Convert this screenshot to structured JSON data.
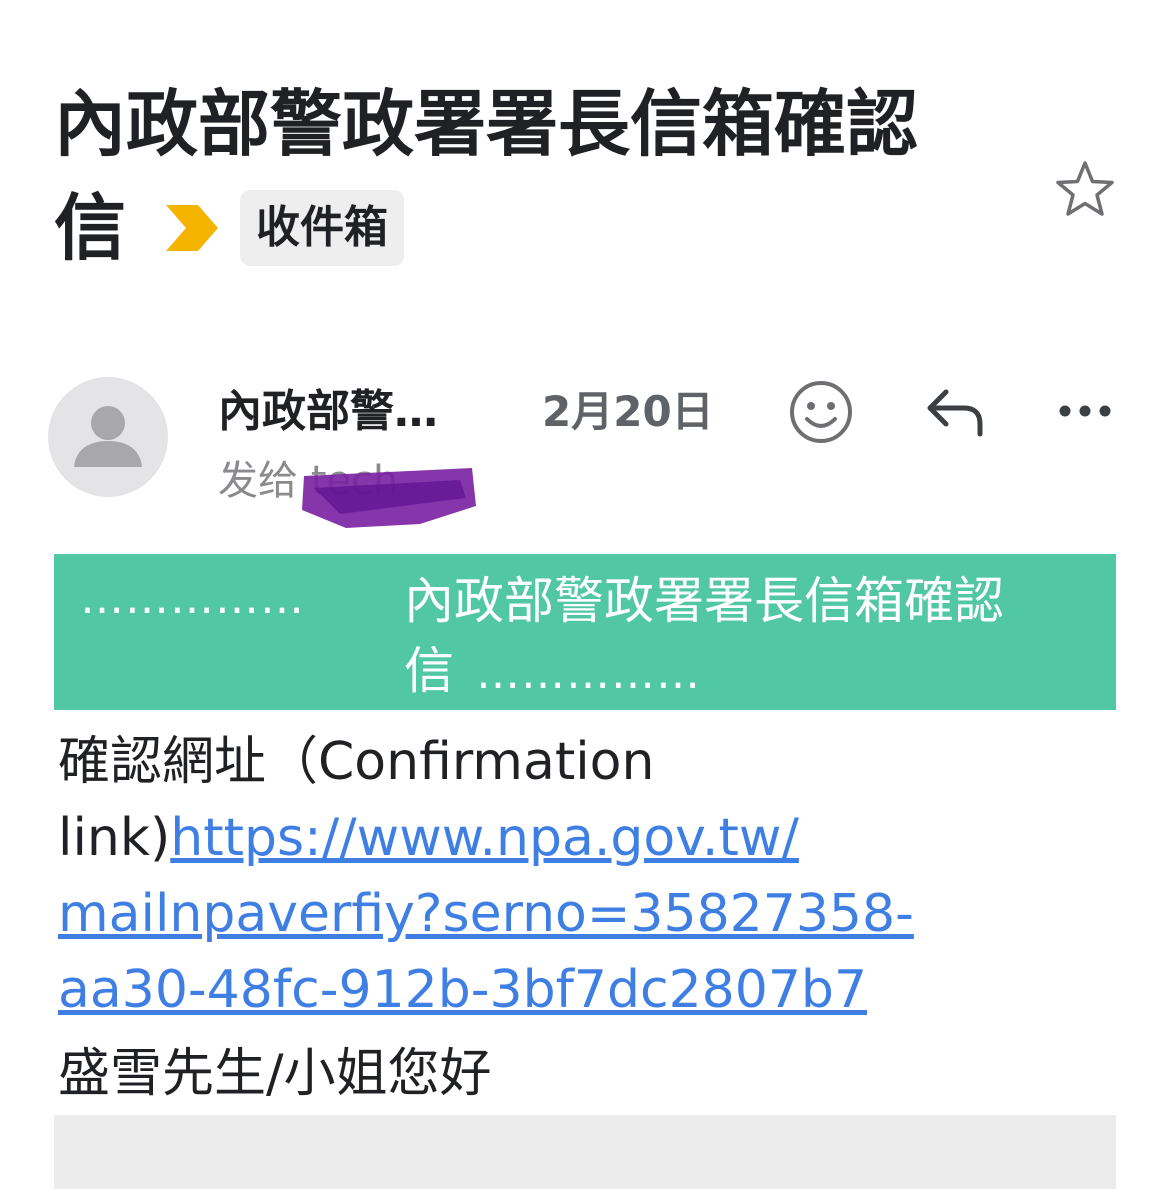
{
  "email": {
    "subject": "內政部警政署署長信箱確認",
    "subject_line2": "信",
    "label": "收件箱",
    "sender": "內政部警…",
    "recipient": "发给 tech",
    "date": "2月20日"
  },
  "banner": {
    "dots_left": "……………",
    "title": "內政部警政署署長信箱確認",
    "title_line2": "信",
    "dots_right": "……………"
  },
  "body": {
    "confirm_label": "確認網址（Confirmation",
    "confirm_label2": "link)",
    "link_part1": "https://www.npa.gov.tw/",
    "link_part2": "mailnpaverfiy?serno=35827358-",
    "link_part3": "aa30-48fc-912b-3bf7dc2807b7",
    "greeting": "盛雪先生/小姐您好"
  },
  "icons": {
    "importance": "importance-marker-icon",
    "star": "star-icon",
    "avatar": "person-avatar-icon",
    "emoji": "emoji-icon",
    "reply": "reply-icon",
    "more": "more-icon"
  },
  "colors": {
    "banner": "#52c7a3",
    "link": "#3f7fe4",
    "importance": "#f5b400",
    "redaction": "#7a1fa2"
  }
}
